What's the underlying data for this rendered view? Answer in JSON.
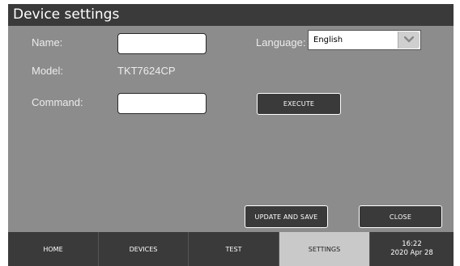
{
  "window": {
    "title": "Device settings"
  },
  "form": {
    "name_label": "Name:",
    "name_value": "",
    "language_label": "Language:",
    "language_selected": "English",
    "model_label": "Model:",
    "model_value": "TKT7624CP",
    "command_label": "Command:",
    "command_value": "",
    "execute_label": "EXECUTE"
  },
  "actions": {
    "update_save_label": "UPDATE AND SAVE",
    "close_label": "CLOSE"
  },
  "nav": {
    "tabs": [
      {
        "label": "HOME",
        "active": false
      },
      {
        "label": "DEVICES",
        "active": false
      },
      {
        "label": "TEST",
        "active": false
      },
      {
        "label": "SETTINGS",
        "active": true
      }
    ],
    "time": "16:22",
    "date": "2020 Apr 28"
  },
  "colors": {
    "titlebar": "#3a3a3a",
    "panel": "#8c8c8c",
    "button": "#3a3a3a",
    "active_tab": "#c9c9c9"
  }
}
